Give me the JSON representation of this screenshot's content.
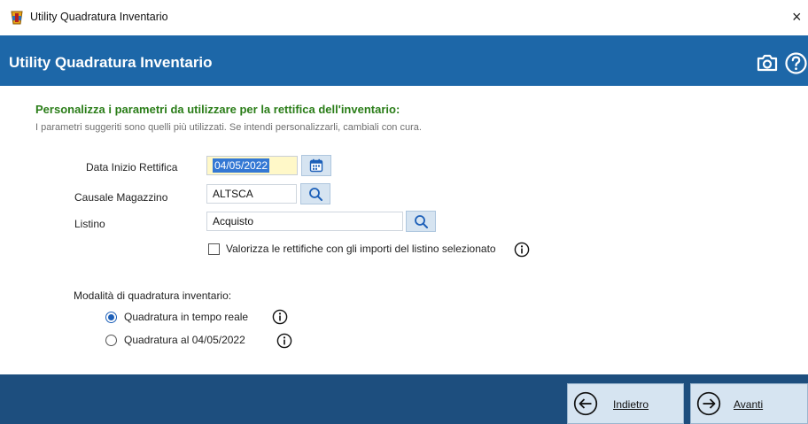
{
  "window": {
    "title": "Utility Quadratura Inventario",
    "close_glyph": "×"
  },
  "header": {
    "title": "Utility Quadratura Inventario",
    "icons": [
      "camera-icon",
      "help-icon"
    ]
  },
  "colors": {
    "header_bg": "#1d67a8",
    "footer_bg": "#1d4e7e",
    "section_title": "#2a7d18",
    "button_bg": "#d6e4f1",
    "date_field_bg": "#fff8c8",
    "selection": "#3478d4"
  },
  "section": {
    "title": "Personalizza i parametri da utilizzare per la rettifica dell'inventario:",
    "subtitle": "I parametri suggeriti sono quelli più utilizzati. Se intendi personalizzarli, cambiali con cura."
  },
  "form": {
    "date_label": "Data Inizio Rettifica",
    "date_value": "04/05/2022",
    "causale_label": "Causale Magazzino",
    "causale_value": "ALTSCA",
    "listino_label": "Listino",
    "listino_value": "Acquisto",
    "checkbox_label": "Valorizza le rettifiche con gli importi del listino selezionato",
    "checkbox_checked": false
  },
  "mode": {
    "label": "Modalità di quadratura inventario:",
    "options": [
      {
        "label": "Quadratura in tempo reale",
        "selected": true
      },
      {
        "label": "Quadratura al 04/05/2022",
        "selected": false
      }
    ]
  },
  "footer": {
    "back_label": "Indietro",
    "next_label": "Avanti"
  }
}
